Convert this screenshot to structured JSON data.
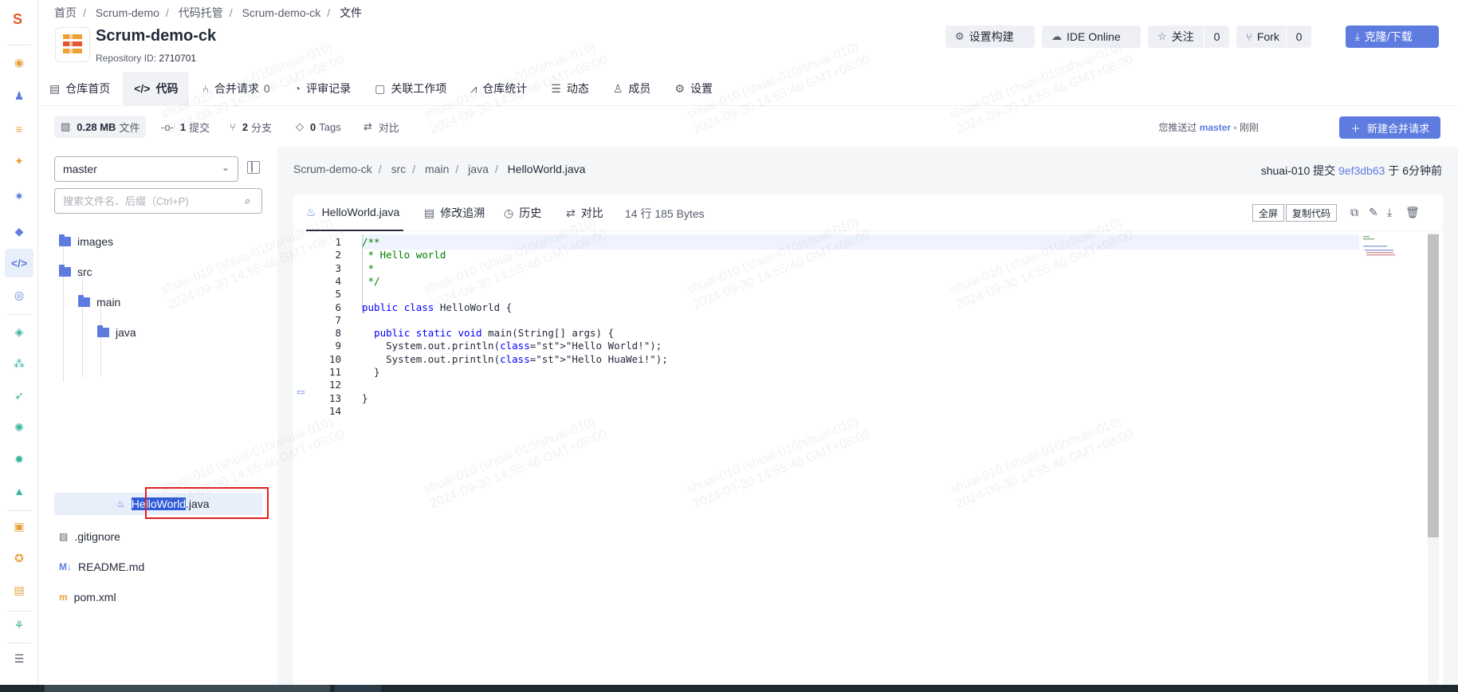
{
  "breadcrumb": [
    "首页",
    "Scrum-demo",
    "代码托管",
    "Scrum-demo-ck",
    "文件"
  ],
  "repo": {
    "name": "Scrum-demo-ck",
    "id_label": "Repository ID:",
    "id": "2710701"
  },
  "header_buttons": {
    "build": "设置构建",
    "ide": "IDE Online",
    "watch": "关注",
    "watch_count": "0",
    "fork": "Fork",
    "fork_count": "0",
    "clone": "克隆/下载"
  },
  "tabs": [
    {
      "label": "仓库首页",
      "icon": "book-icon"
    },
    {
      "label": "代码",
      "icon": "code-icon",
      "active": true
    },
    {
      "label": "合并请求",
      "icon": "merge-icon",
      "badge": "0"
    },
    {
      "label": "评审记录",
      "icon": "review-icon"
    },
    {
      "label": "关联工作项",
      "icon": "doc-icon"
    },
    {
      "label": "仓库统计",
      "icon": "chart-icon"
    },
    {
      "label": "动态",
      "icon": "list-icon"
    },
    {
      "label": "成员",
      "icon": "user-icon"
    },
    {
      "label": "设置",
      "icon": "gear-icon"
    }
  ],
  "stats": {
    "size": "0.28 MB",
    "size_label": "文件",
    "commits": "1",
    "commits_label": "提交",
    "branches": "2",
    "branches_label": "分支",
    "tags": "0",
    "tags_label": "Tags",
    "compare": "对比"
  },
  "pushed": {
    "prefix": "您推送过",
    "branch": "master",
    "suffix": "刚刚"
  },
  "new_mr": "新建合并请求",
  "tree": {
    "branch": "master",
    "search_placeholder": "搜索文件名、后缀（Ctrl+P)",
    "items": {
      "images": "images",
      "src": "src",
      "main": "main",
      "java": "java",
      "file_hl": "HelloWorld",
      "file_rest": ".java",
      "gitignore": ".gitignore",
      "readme": "README.md",
      "pom": "pom.xml"
    }
  },
  "path": {
    "parts": [
      "Scrum-demo-ck",
      "src",
      "main",
      "java"
    ],
    "current": "HelloWorld.java"
  },
  "commit": {
    "author": "shuai-010",
    "verb": "提交",
    "hash": "9ef3db63",
    "time": "于 6分钟前"
  },
  "file": {
    "tab": "HelloWorld.java",
    "blame": "修改追溯",
    "history": "历史",
    "compare": "对比",
    "meta": "14 行  185 Bytes",
    "fullscreen": "全屏",
    "copy": "复制代码"
  },
  "code_lines": [
    "/**",
    " * Hello world",
    " *",
    " */",
    "",
    "public class HelloWorld {",
    "",
    "  public static void main(String[] args) {",
    "    System.out.println(\"Hello World!\");",
    "    System.out.println(\"Hello HuaWei!\");",
    "  }",
    "",
    "}",
    ""
  ],
  "watermark": "shuai-010 (shuai-010/shuai-010)\n2024-09-30 14:55:46 GMT+08:00",
  "colors": {
    "accent": "#5e7ce0",
    "highlight": "#e02020"
  }
}
